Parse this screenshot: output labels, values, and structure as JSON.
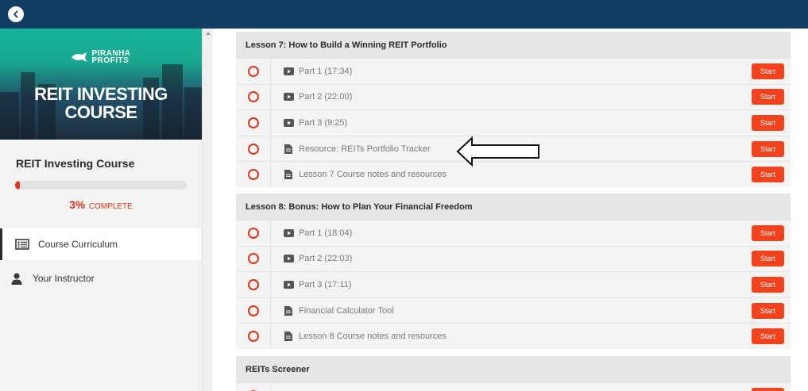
{
  "sidebar": {
    "hero": {
      "logo_line1": "PIRANHA",
      "logo_line2": "PROFITS",
      "title_line1": "REIT INVESTING",
      "title_line2": "COURSE"
    },
    "course_name": "REIT Investing Course",
    "progress": {
      "fraction": 0.03,
      "percent_text": "3%",
      "complete_text": "COMPLETE"
    },
    "nav": {
      "curriculum": "Course Curriculum",
      "instructor": "Your Instructor"
    }
  },
  "lessons": [
    {
      "title": "Lesson 7: How to Build a Winning REIT Portfolio",
      "items": [
        {
          "type": "video",
          "label": "Part 1 (17:34)",
          "action": "Start"
        },
        {
          "type": "video",
          "label": "Part 2 (22:00)",
          "action": "Start"
        },
        {
          "type": "video",
          "label": "Part 3 (9:25)",
          "action": "Start"
        },
        {
          "type": "document",
          "label": "Resource: REITs Portfolio Tracker",
          "action": "Start"
        },
        {
          "type": "document",
          "label": "Lesson 7 Course notes and resources",
          "action": "Start"
        }
      ]
    },
    {
      "title": "Lesson 8: Bonus: How to Plan Your Financial Freedom",
      "items": [
        {
          "type": "video",
          "label": "Part 1 (18:04)",
          "action": "Start"
        },
        {
          "type": "video",
          "label": "Part 2 (22:03)",
          "action": "Start"
        },
        {
          "type": "video",
          "label": "Part 3 (17:11)",
          "action": "Start"
        },
        {
          "type": "document",
          "label": "Financial Calculator Tool",
          "action": "Start"
        },
        {
          "type": "document",
          "label": "Lesson 8 Course notes and resources",
          "action": "Start"
        }
      ]
    },
    {
      "title": "REITs Screener",
      "items": [
        {
          "type": "document",
          "label": "",
          "action": ""
        }
      ]
    }
  ],
  "icons": {
    "back": "chevron-left-icon",
    "video": "play-icon",
    "document": "document-icon",
    "curriculum": "list-icon",
    "instructor": "user-icon",
    "annotation": "arrow-left-icon"
  },
  "colors": {
    "topbar": "#123e64",
    "accent": "#e5341a",
    "start_button": "#f4421c",
    "hero_teal": "#14b39a"
  }
}
